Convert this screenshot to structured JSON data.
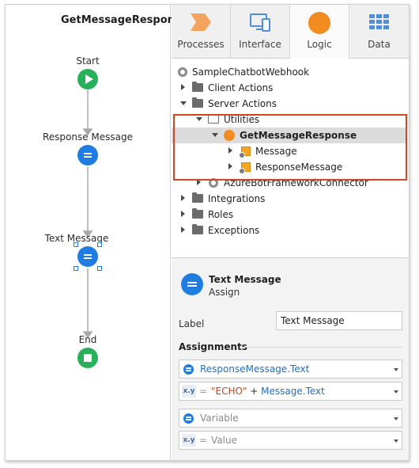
{
  "canvas": {
    "title": "GetMessageResponse",
    "nodes": [
      {
        "label": "Start",
        "kind": "start"
      },
      {
        "label": "Response Message",
        "kind": "assign"
      },
      {
        "label": "Text Message",
        "kind": "assign",
        "selected": true
      },
      {
        "label": "End",
        "kind": "end"
      }
    ]
  },
  "tabs": [
    {
      "label": "Processes",
      "icon": "processes-chevron-icon"
    },
    {
      "label": "Interface",
      "icon": "interface-devices-icon"
    },
    {
      "label": "Logic",
      "icon": "logic-circle-icon",
      "active": true
    },
    {
      "label": "Data",
      "icon": "data-grid-icon"
    }
  ],
  "tree": [
    {
      "label": "SampleChatbotWebhook",
      "icon": "module-icon",
      "expander": "none"
    },
    {
      "label": "Client Actions",
      "icon": "folder-icon",
      "expander": "collapsed"
    },
    {
      "label": "Server Actions",
      "icon": "folder-icon",
      "expander": "expanded"
    },
    {
      "label": "Utilities",
      "icon": "folder-open-icon",
      "expander": "expanded"
    },
    {
      "label": "GetMessageResponse",
      "icon": "server-action-icon",
      "expander": "expanded",
      "selected": true
    },
    {
      "label": "Message",
      "icon": "input-parameter-icon",
      "expander": "collapsed"
    },
    {
      "label": "ResponseMessage",
      "icon": "output-parameter-icon",
      "expander": "collapsed"
    },
    {
      "label": "AzureBotFrameworkConnector",
      "icon": "module-icon",
      "expander": "collapsed"
    },
    {
      "label": "Integrations",
      "icon": "folder-icon",
      "expander": "collapsed"
    },
    {
      "label": "Roles",
      "icon": "folder-icon",
      "expander": "collapsed"
    },
    {
      "label": "Exceptions",
      "icon": "folder-icon",
      "expander": "collapsed"
    }
  ],
  "highlight_color": "#d3461e",
  "properties": {
    "name": "Text Message",
    "kind": "Assign",
    "label_key": "Label",
    "label_value": "Text Message",
    "assignments_title": "Assignments",
    "assignments": [
      {
        "variable": "ResponseMessage.Text",
        "eq": "=",
        "value_string": "\"ECHO\"",
        "value_plus": " + ",
        "value_ref": "Message.Text"
      },
      {
        "variable_placeholder": "Variable",
        "eq": "=",
        "value_placeholder": "Value"
      }
    ],
    "xy_badge": "x.y"
  }
}
